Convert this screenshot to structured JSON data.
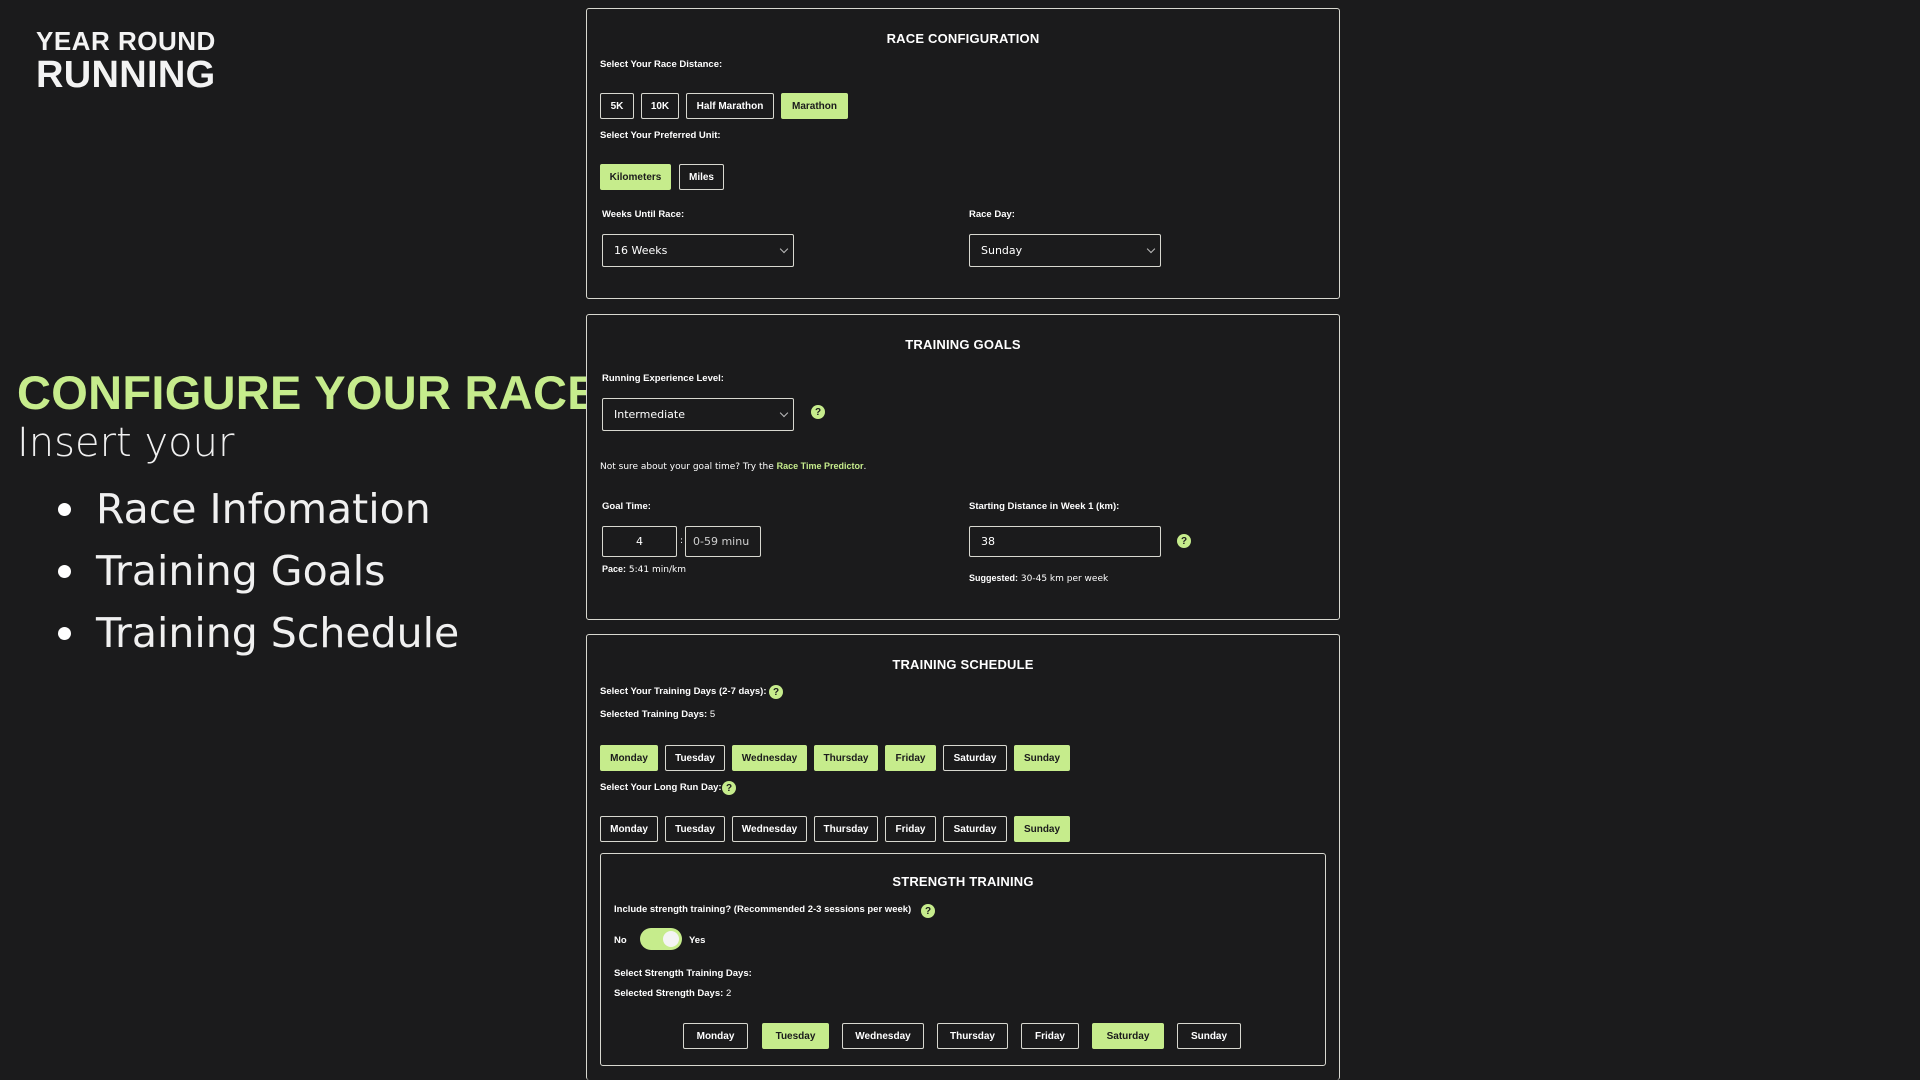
{
  "brand": {
    "line1": "YEAR ROUND",
    "line2": "RUNNING"
  },
  "hero": {
    "title": "CONFIGURE YOUR RACE",
    "subtitle": "Insert your",
    "items": [
      "Race Infomation",
      "Training Goals",
      "Training Schedule"
    ]
  },
  "race": {
    "title": "RACE CONFIGURATION",
    "distance_label": "Select Your Race Distance:",
    "distances": [
      "5K",
      "10K",
      "Half Marathon",
      "Marathon"
    ],
    "unit_label": "Select Your Preferred Unit:",
    "units": [
      "Kilometers",
      "Miles"
    ],
    "weeks_label": "Weeks Until Race:",
    "weeks_value": "16 Weeks",
    "day_label": "Race Day:",
    "day_value": "Sunday"
  },
  "goals": {
    "title": "TRAINING GOALS",
    "experience_label": "Running Experience Level:",
    "experience_value": "Intermediate",
    "help": "?",
    "predictor_text": "Not sure about your goal time? Try the",
    "predictor_link": "Race Time Predictor",
    "predictor_end": ".",
    "goal_label": "Goal Time:",
    "goal_hours": "4",
    "goal_sep": ":",
    "goal_minutes_placeholder": "0-59 minu",
    "pace_label": "Pace:",
    "pace_value": "5:41 min/km",
    "start_label": "Starting Distance in Week 1 (km):",
    "start_value": "38",
    "suggested_label": "Suggested:",
    "suggested_value": "30-45 km per week"
  },
  "schedule": {
    "title": "TRAINING SCHEDULE",
    "days_label": "Select Your Training Days (2-7 days):",
    "selected_label": "Selected Training Days:",
    "selected_count": "5",
    "days": [
      "Monday",
      "Tuesday",
      "Wednesday",
      "Thursday",
      "Friday",
      "Saturday",
      "Sunday"
    ],
    "long_label": "Select Your Long Run Day:"
  },
  "strength": {
    "title": "STRENGTH TRAINING",
    "include_label": "Include strength training? (Recommended 2-3 sessions per week)",
    "no": "No",
    "yes": "Yes",
    "days_label": "Select Strength Training Days:",
    "selected_label": "Selected Strength Days:",
    "selected_count": "2"
  },
  "colors": {
    "accent": "#c6ec8c",
    "background": "#1b1b1c",
    "border": "#d8d8d0"
  }
}
